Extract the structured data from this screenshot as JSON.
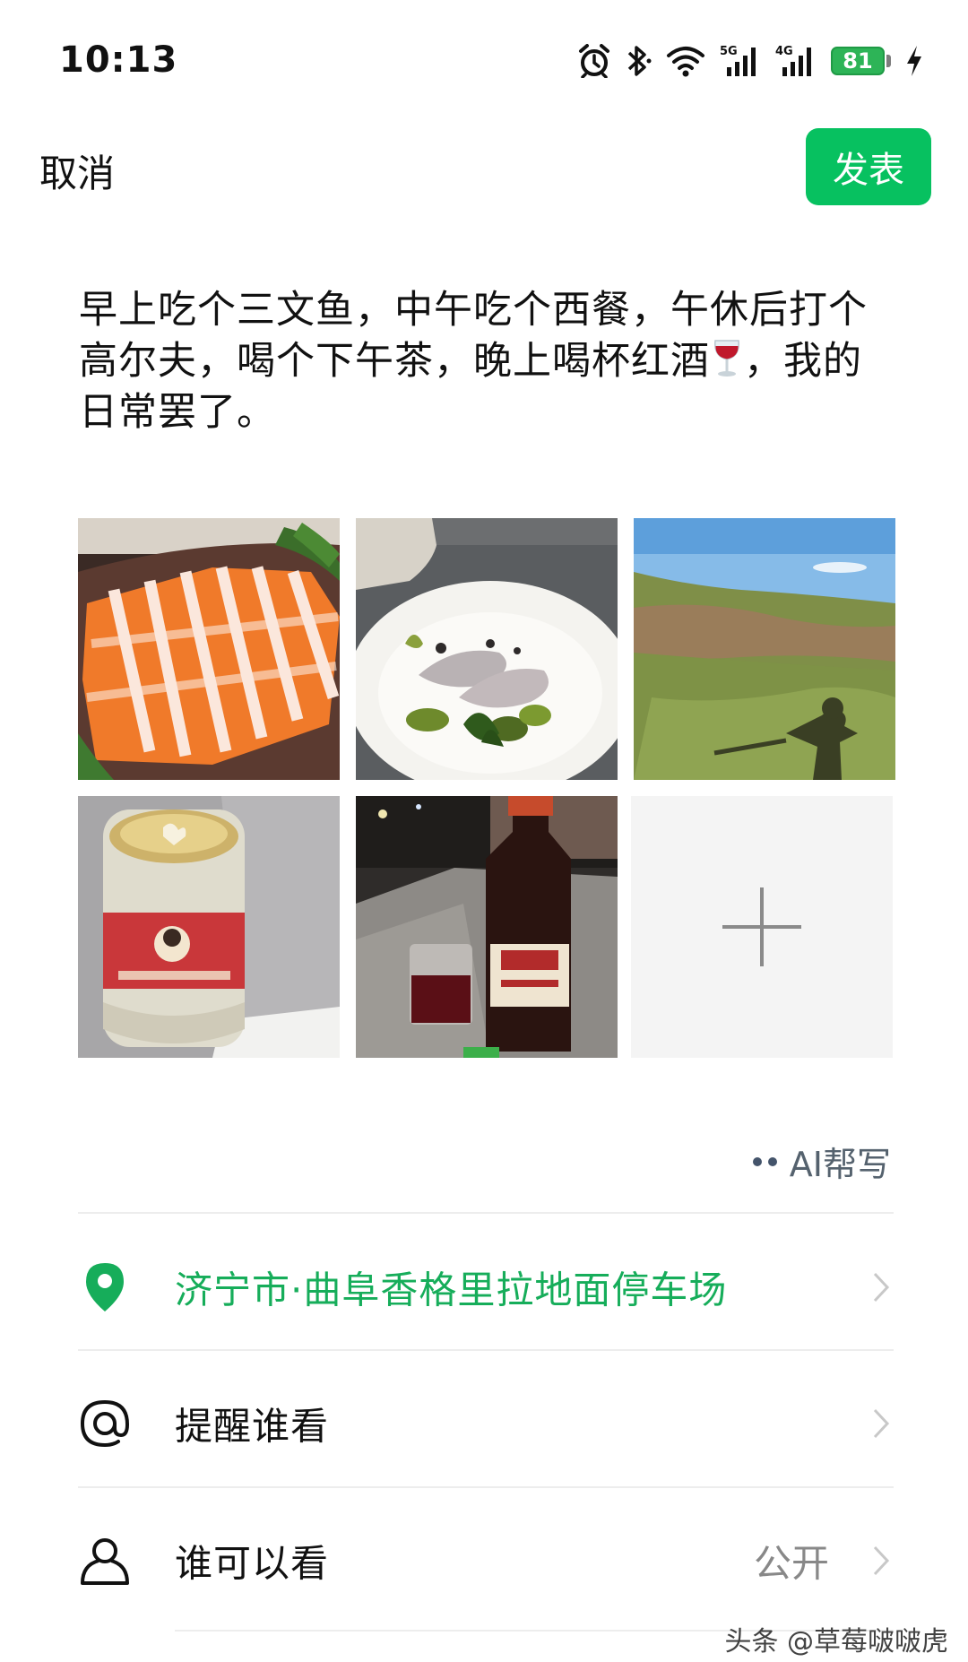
{
  "status_bar": {
    "time": "10:13",
    "battery_level": "81",
    "network_labels": [
      "5G",
      "4G"
    ],
    "icons": [
      "alarm-icon",
      "bluetooth-icon",
      "wifi-icon",
      "signal-5g-icon",
      "signal-4g-icon",
      "battery-icon",
      "charging-icon"
    ],
    "battery_color": "#2db457"
  },
  "top_bar": {
    "cancel_label": "取消",
    "publish_label": "发表",
    "publish_color": "#07c160"
  },
  "post": {
    "text_part1": "早上吃个三文鱼，中午吃个西餐，午休后打个高尔夫，喝个下午茶，晚上喝杯红酒",
    "emoji": "wine-glass-emoji",
    "text_part2": "，我的日常罢了。"
  },
  "photos": [
    {
      "name": "salmon-sashimi-photo"
    },
    {
      "name": "western-dish-photo"
    },
    {
      "name": "field-shadow-photo"
    },
    {
      "name": "latte-jar-photo"
    },
    {
      "name": "soy-sauce-wine-photo"
    }
  ],
  "add_photo_icon": "plus-icon",
  "ai_helper": {
    "label": "AI帮写"
  },
  "rows": {
    "location": {
      "label": "济宁市·曲阜香格里拉地面停车场",
      "icon": "location-pin-icon",
      "color": "#16ad5a"
    },
    "remind": {
      "label": "提醒谁看",
      "icon": "at-icon"
    },
    "visibility": {
      "label": "谁可以看",
      "value": "公开",
      "icon": "person-icon"
    }
  },
  "watermark": "头条 @草莓啵啵虎"
}
